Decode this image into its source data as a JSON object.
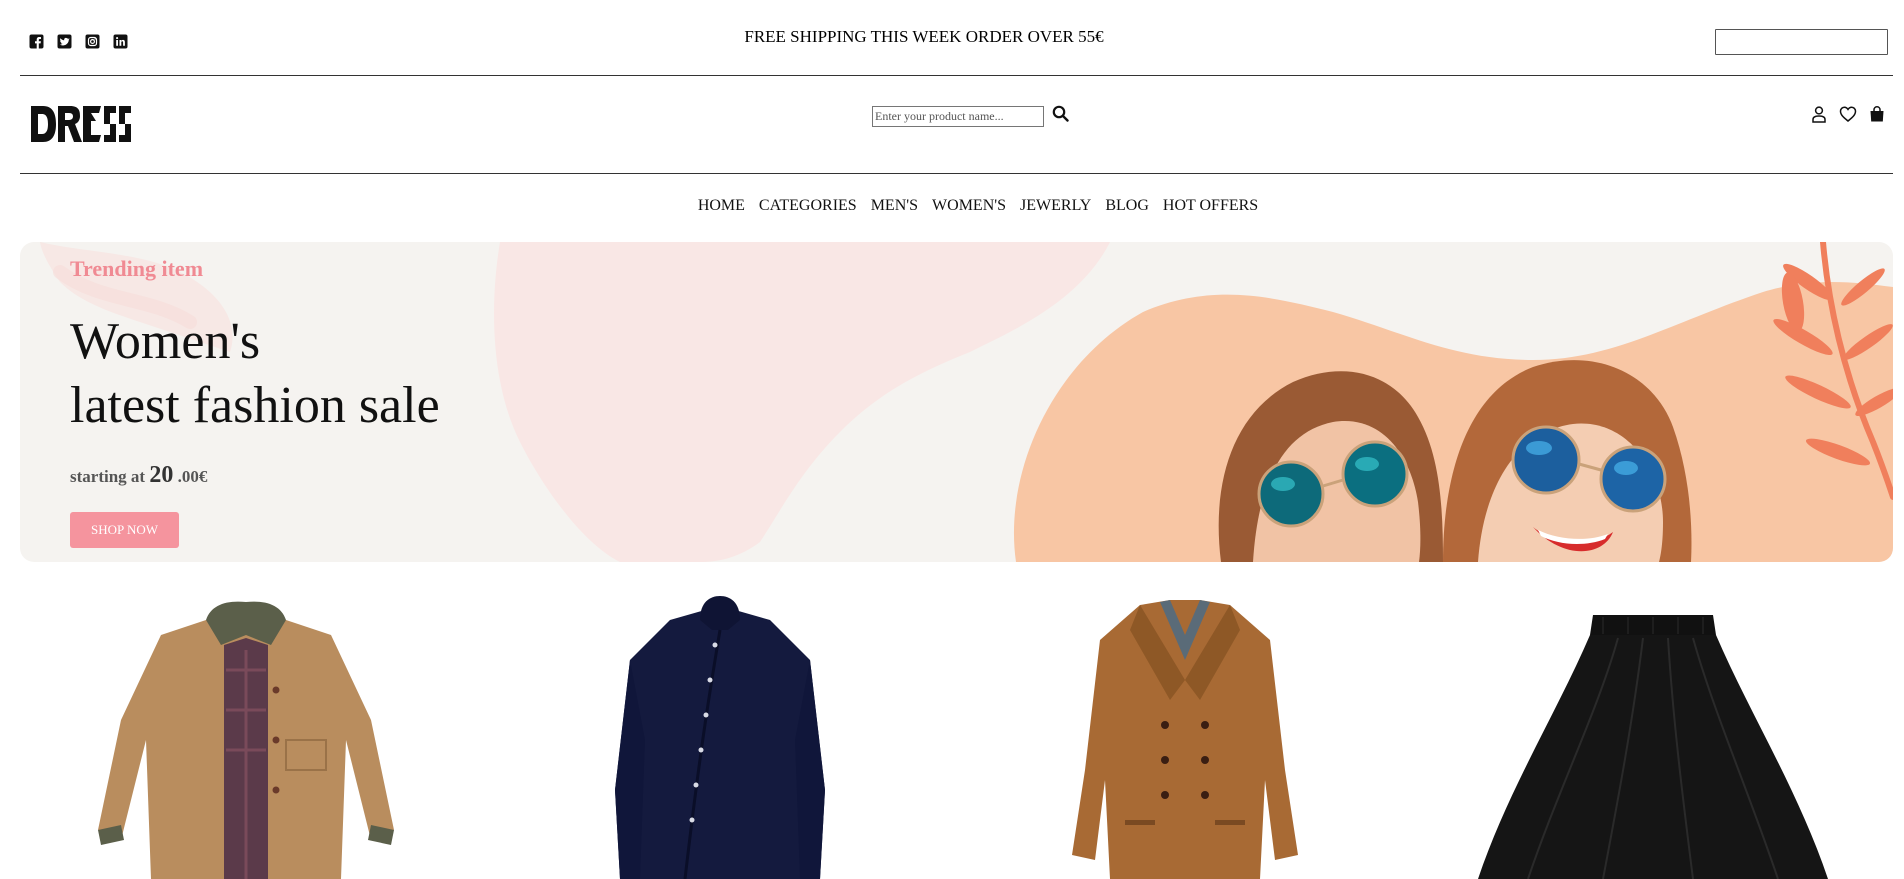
{
  "topbar": {
    "social": [
      "facebook-icon",
      "twitter-icon",
      "instagram-icon",
      "linkedin-icon"
    ],
    "shipping_text": "FREE SHIPPING THIS WEEK ORDER OVER 55€"
  },
  "header": {
    "logo_text": "DRESS",
    "search_placeholder": "Enter your product name...",
    "icons": [
      "user-icon",
      "heart-icon",
      "shopping-bag-icon"
    ]
  },
  "nav": {
    "items": [
      "HOME",
      "CATEGORIES",
      "MEN'S",
      "WOMEN'S",
      "JEWERLY",
      "BLOG",
      "HOT OFFERS"
    ]
  },
  "hero": {
    "eyebrow": "Trending item",
    "headline_line1": "Women's",
    "headline_line2": "latest fashion sale",
    "starting_label": "starting at",
    "price_whole": "20",
    "price_fraction": ".00€",
    "button_label": "SHOP NOW"
  },
  "colors": {
    "accent": "#f5949e",
    "eyebrow": "#f08a93",
    "hero_bg": "#f5f3f0",
    "peach": "#f8c6a4"
  },
  "products": [
    "tan-work-jacket",
    "navy-asymmetric-shirt",
    "camel-double-breasted-coat",
    "black-pleated-skirt"
  ]
}
